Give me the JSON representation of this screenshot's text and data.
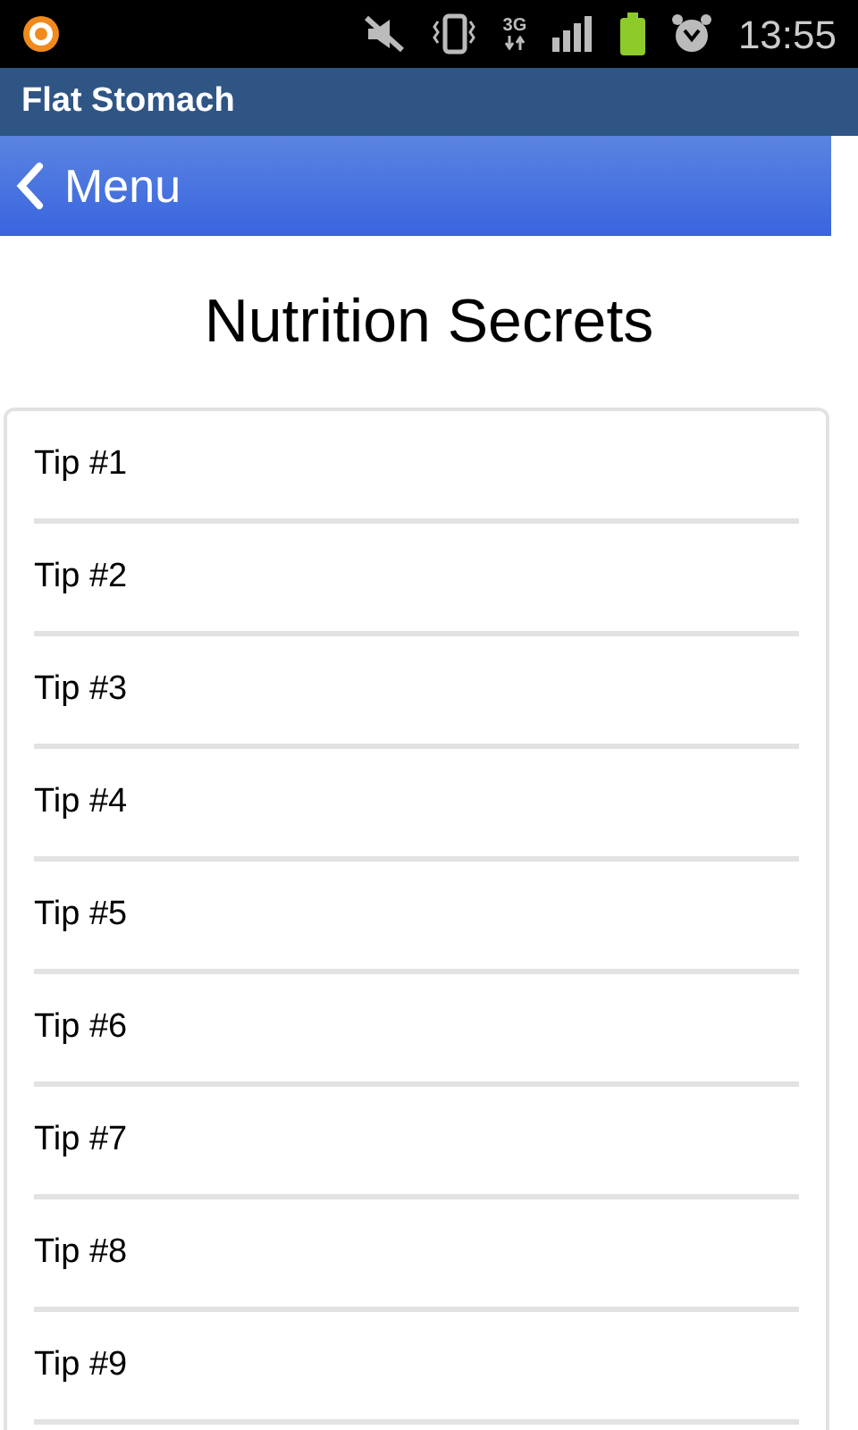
{
  "status_bar": {
    "network": "3G",
    "time": "13:55"
  },
  "app_bar": {
    "title": "Flat Stomach"
  },
  "nav_bar": {
    "back_label": "Menu"
  },
  "page": {
    "title": "Nutrition Secrets"
  },
  "tips": [
    {
      "label": "Tip #1"
    },
    {
      "label": "Tip #2"
    },
    {
      "label": "Tip #3"
    },
    {
      "label": "Tip #4"
    },
    {
      "label": "Tip #5"
    },
    {
      "label": "Tip #6"
    },
    {
      "label": "Tip #7"
    },
    {
      "label": "Tip #8"
    },
    {
      "label": "Tip #9"
    }
  ]
}
